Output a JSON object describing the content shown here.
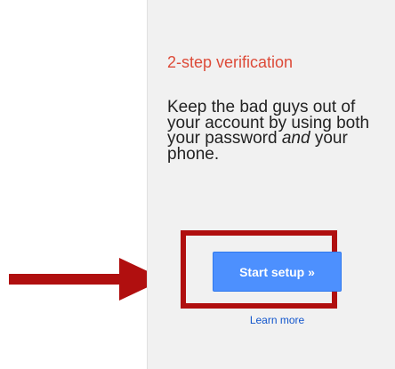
{
  "card": {
    "title": "2-step verification",
    "description_before": "Keep the bad guys out of your account by using both your password ",
    "description_emphasis": "and",
    "description_after": " your phone.",
    "start_button_label": "Start setup »",
    "learn_more_label": "Learn more"
  },
  "annotation": {
    "arrow_icon": "arrow-right-icon",
    "highlight_color": "#b00f0f"
  },
  "colors": {
    "title": "#dd4b39",
    "button": "#4d90fe",
    "link": "#1155cc",
    "panel_background": "#f1f1f1"
  }
}
